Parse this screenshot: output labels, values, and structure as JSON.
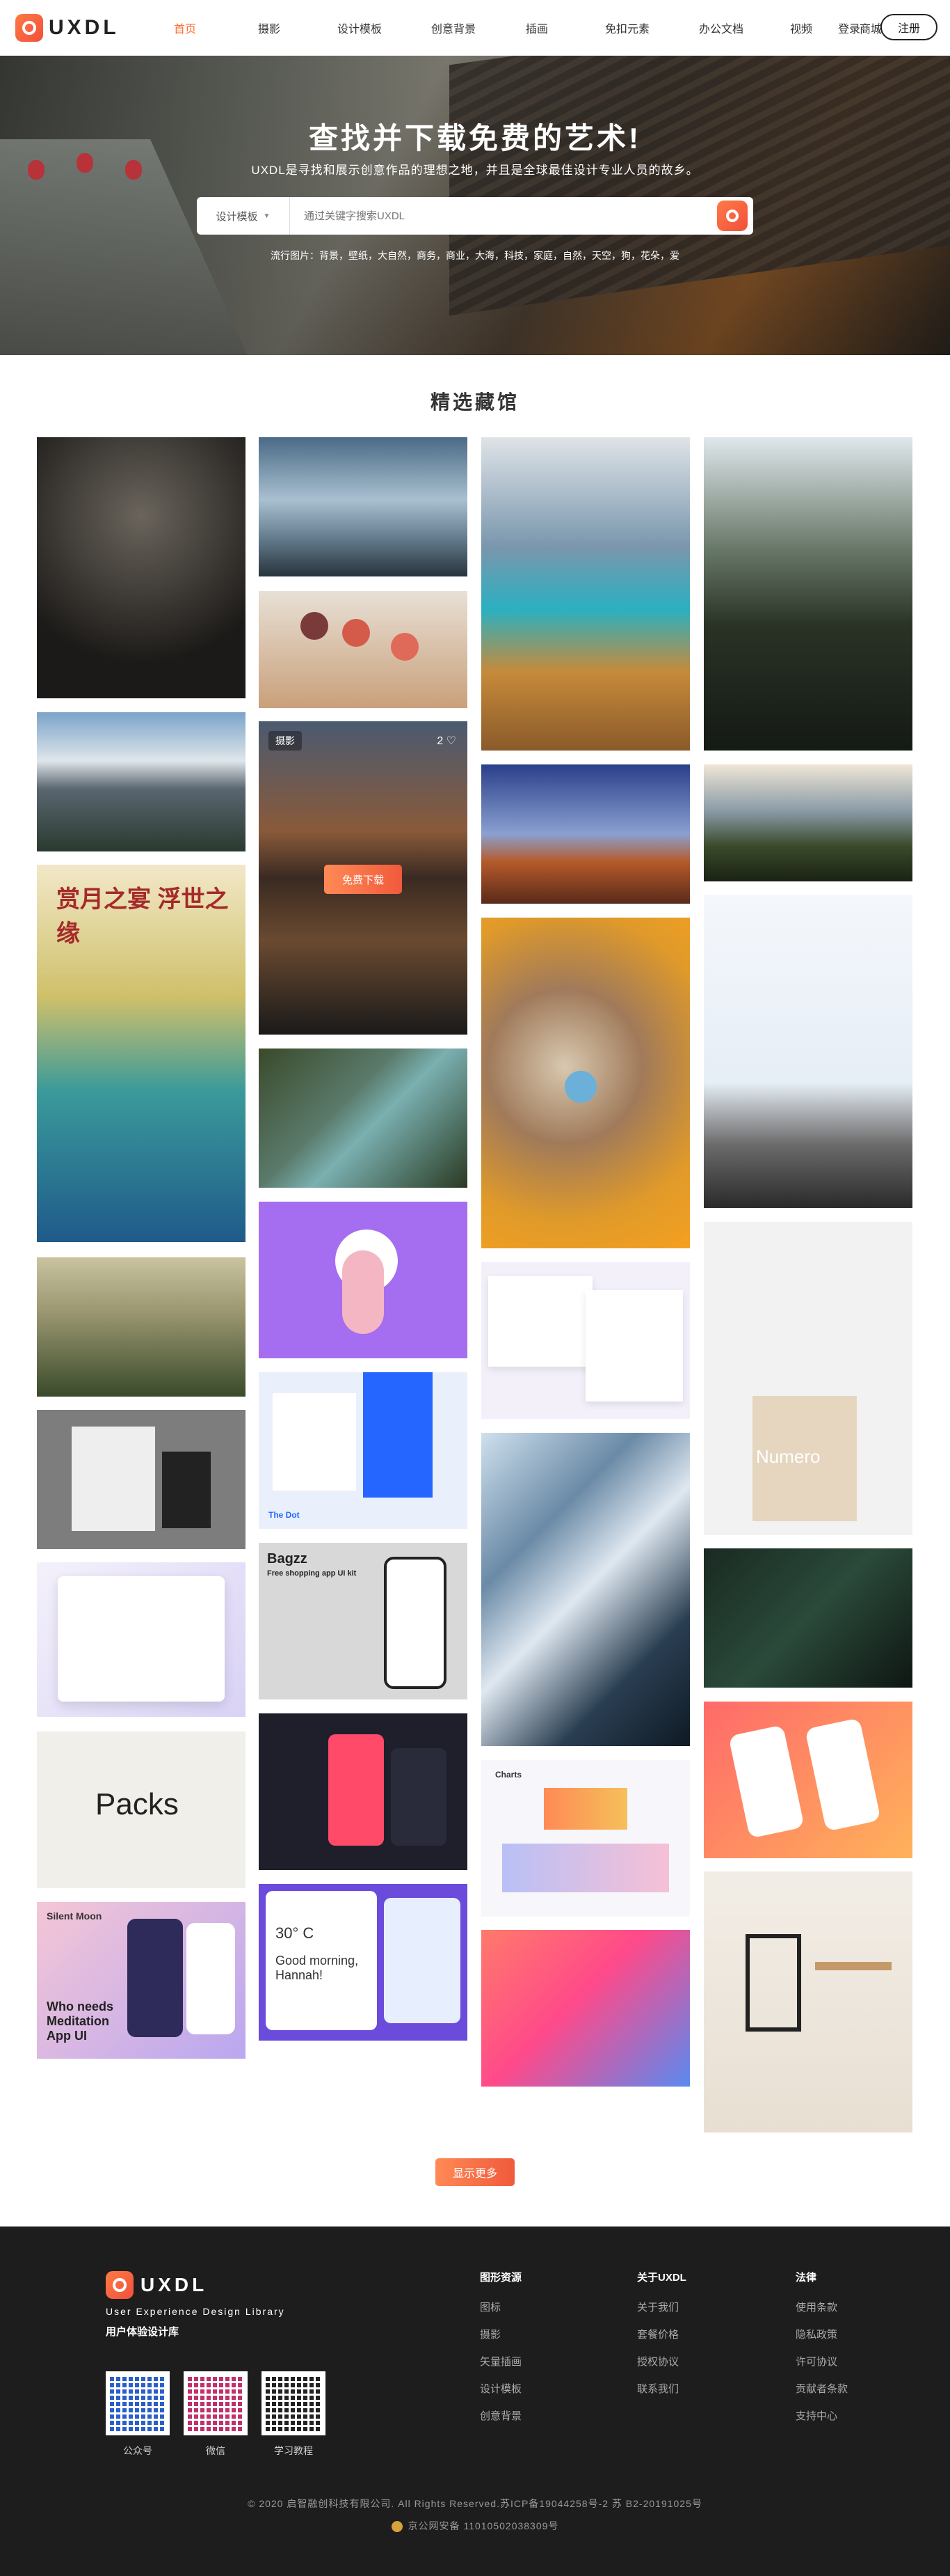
{
  "brand": {
    "name": "UXDL"
  },
  "nav": {
    "items": [
      "首页",
      "摄影",
      "设计模板",
      "创意背景",
      "插画",
      "免扣元素",
      "办公文档",
      "视频",
      "商城"
    ],
    "login": "登录",
    "register": "注册"
  },
  "hero": {
    "title": "查找并下载免费的艺术!",
    "subtitle": "UXDL是寻找和展示创意作品的理想之地，并且是全球最佳设计专业人员的故乡。",
    "search_category": "设计模板",
    "search_placeholder": "通过关键字搜索UXDL",
    "tags": "流行图片：背景，壁纸，大自然，商务，商业，大海，科技，家庭，自然，天空，狗，花朵，爱"
  },
  "gallery": {
    "title": "精选藏馆",
    "hover_tag": "摄影",
    "hover_likes": "2 ♡",
    "download_label": "免费下载",
    "poster_title": "赏月之宴 浮世之缘",
    "packs_label": "Packs",
    "bagzz_title": "Bagzz",
    "bagzz_sub": "Free shopping app UI kit",
    "meditation_title": "Who needs Meditation App UI",
    "meditation_brand": "Silent  Moon",
    "weather_temp": "30° C",
    "weather_greeting": "Good morning, Hannah!",
    "numero_label": "Numero",
    "dot_label": "The Dot",
    "charts_label": "Charts"
  },
  "more_button": "显示更多",
  "footer": {
    "brand": "UXDL",
    "slogan": "User Experience Design Library",
    "slogan_cn": "用户体验设计库",
    "qr_labels": [
      "公众号",
      "微信",
      "学习教程"
    ],
    "columns": [
      {
        "title": "图形资源",
        "links": [
          "图标",
          "摄影",
          "矢量插画",
          "设计模板",
          "创意背景"
        ]
      },
      {
        "title": "关于UXDL",
        "links": [
          "关于我们",
          "套餐价格",
          "授权协议",
          "联系我们"
        ]
      },
      {
        "title": "法律",
        "links": [
          "使用条款",
          "隐私政策",
          "许可协议",
          "贡献者条款",
          "支持中心"
        ]
      }
    ],
    "copyright": "© 2020 启智融创科技有限公司. All Rights Reserved.苏ICP备19044258号-2  苏 B2-20191025号",
    "icp": "京公网安备 11010502038309号"
  },
  "colors": {
    "accent": "#ff6a2f",
    "footer_bg": "#1d1d1d"
  }
}
